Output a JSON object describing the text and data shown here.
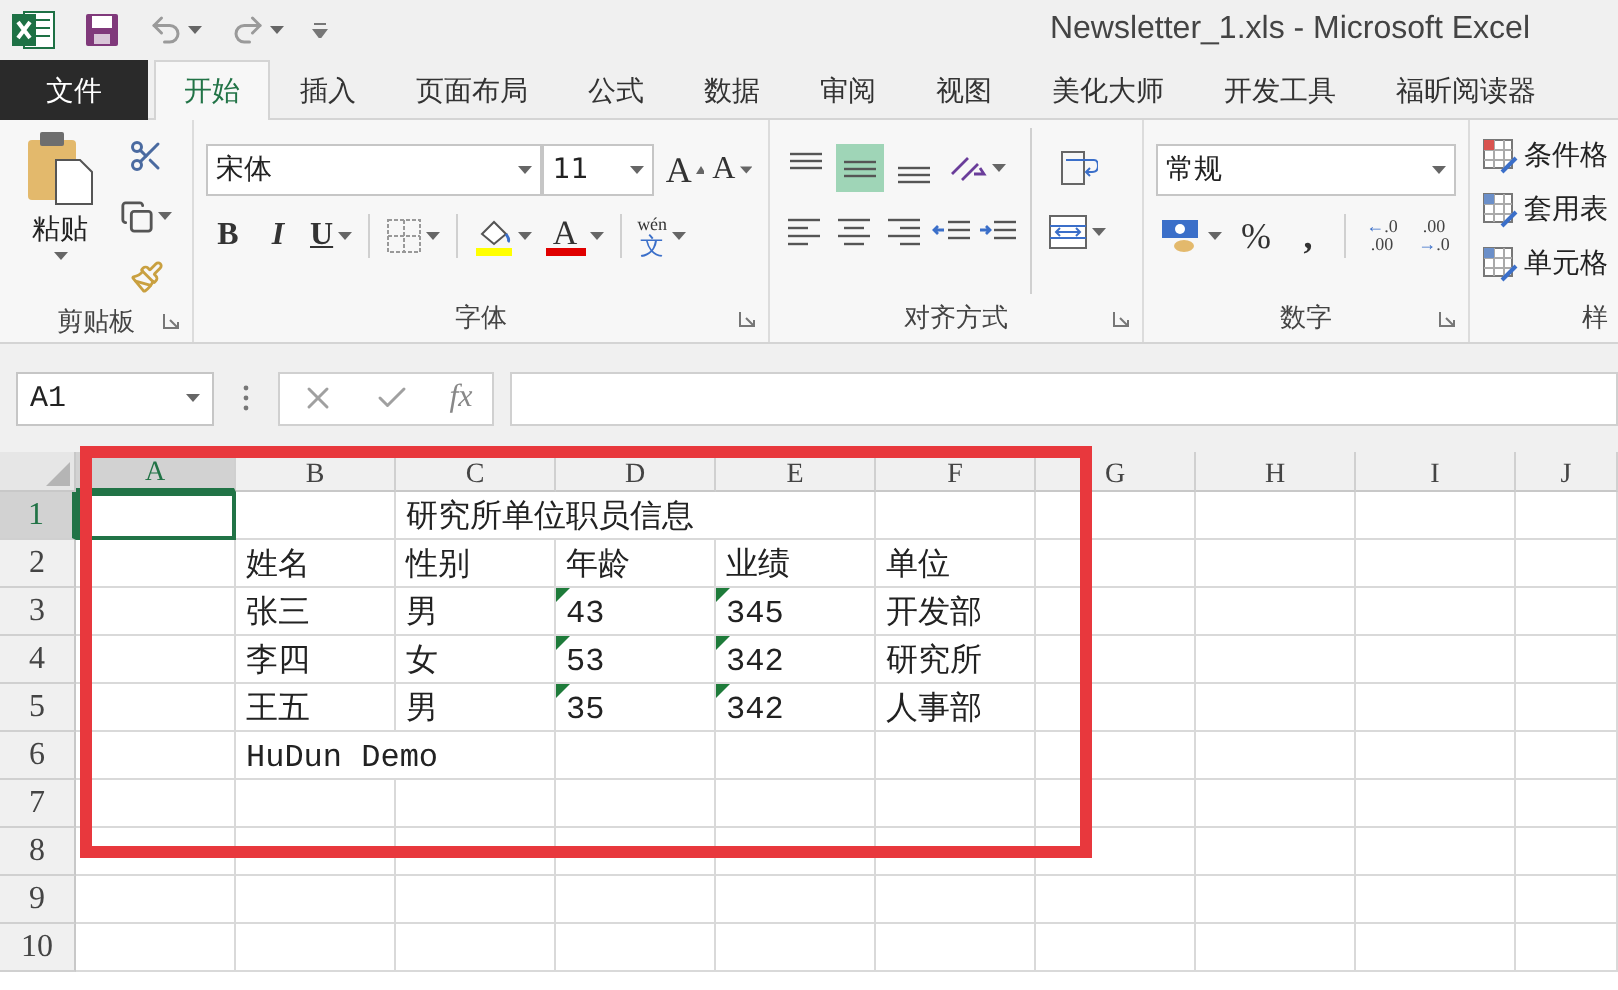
{
  "title_bar": {
    "title": "Newsletter_1.xls - Microsoft Excel"
  },
  "ribbon_tabs": [
    {
      "label": "文件",
      "kind": "file",
      "selected": false
    },
    {
      "label": "开始",
      "kind": "tab",
      "selected": true
    },
    {
      "label": "插入",
      "kind": "tab",
      "selected": false
    },
    {
      "label": "页面布局",
      "kind": "tab",
      "selected": false
    },
    {
      "label": "公式",
      "kind": "tab",
      "selected": false
    },
    {
      "label": "数据",
      "kind": "tab",
      "selected": false
    },
    {
      "label": "审阅",
      "kind": "tab",
      "selected": false
    },
    {
      "label": "视图",
      "kind": "tab",
      "selected": false
    },
    {
      "label": "美化大师",
      "kind": "tab",
      "selected": false
    },
    {
      "label": "开发工具",
      "kind": "tab",
      "selected": false
    },
    {
      "label": "福昕阅读器",
      "kind": "tab",
      "selected": false
    }
  ],
  "ribbon": {
    "clipboard": {
      "paste": "粘贴",
      "label": "剪贴板"
    },
    "font": {
      "name": "宋体",
      "size": "11",
      "grow": "A",
      "shrink": "A",
      "bold": "B",
      "italic": "I",
      "underline": "U",
      "font_color": "A",
      "phonetic": {
        "pinyin": "wén",
        "hanzi": "文"
      },
      "label": "字体"
    },
    "alignment": {
      "vertical": [
        {
          "kind": "top",
          "selected": false
        },
        {
          "kind": "middle",
          "selected": true
        },
        {
          "kind": "bottom",
          "selected": false
        }
      ],
      "label": "对齐方式"
    },
    "number": {
      "format": "常规",
      "percent": "%",
      "comma": ",",
      "increase_decimal": {
        "arrow": "←",
        "top": ".0",
        "bottom": ".00"
      },
      "decrease_decimal": {
        "top": ".00",
        "arrow": "→",
        "bottom": ".0"
      },
      "label": "数字"
    },
    "styles": {
      "items": [
        "条件格",
        "套用表",
        "单元格"
      ],
      "label": "样"
    }
  },
  "formula_bar": {
    "name_box": "A1",
    "function_label": "fx"
  },
  "sheet": {
    "columns": [
      {
        "label": "A",
        "selected": true
      },
      {
        "label": "B",
        "selected": false
      },
      {
        "label": "C",
        "selected": false
      },
      {
        "label": "D",
        "selected": false
      },
      {
        "label": "E",
        "selected": false
      },
      {
        "label": "F",
        "selected": false
      },
      {
        "label": "G",
        "selected": false
      },
      {
        "label": "H",
        "selected": false
      },
      {
        "label": "I",
        "selected": false
      },
      {
        "label": "J",
        "selected": false
      }
    ],
    "rows": [
      {
        "header": "1",
        "selected": true,
        "cells": [
          {
            "kind": "empty"
          },
          {
            "kind": "empty"
          },
          {
            "kind": "text",
            "text": "研究所单位职员信息",
            "warning": false
          }
        ]
      },
      {
        "header": "2",
        "selected": false,
        "cells": [
          {
            "kind": "empty"
          },
          {
            "kind": "text",
            "text": "姓名",
            "warning": false
          },
          {
            "kind": "text",
            "text": "性别",
            "warning": false
          },
          {
            "kind": "text",
            "text": "年龄",
            "warning": false
          },
          {
            "kind": "text",
            "text": "业绩",
            "warning": false
          },
          {
            "kind": "text",
            "text": "单位",
            "warning": false
          }
        ]
      },
      {
        "header": "3",
        "selected": false,
        "cells": [
          {
            "kind": "empty"
          },
          {
            "kind": "text",
            "text": "张三",
            "warning": false
          },
          {
            "kind": "text",
            "text": "男",
            "warning": false
          },
          {
            "kind": "text",
            "text": "43",
            "warning": true
          },
          {
            "kind": "text",
            "text": "345",
            "warning": true
          },
          {
            "kind": "text",
            "text": "开发部",
            "warning": false
          }
        ]
      },
      {
        "header": "4",
        "selected": false,
        "cells": [
          {
            "kind": "empty"
          },
          {
            "kind": "text",
            "text": "李四",
            "warning": false
          },
          {
            "kind": "text",
            "text": "女",
            "warning": false
          },
          {
            "kind": "text",
            "text": "53",
            "warning": true
          },
          {
            "kind": "text",
            "text": "342",
            "warning": true
          },
          {
            "kind": "text",
            "text": "研究所",
            "warning": false
          }
        ]
      },
      {
        "header": "5",
        "selected": false,
        "cells": [
          {
            "kind": "empty"
          },
          {
            "kind": "text",
            "text": "王五",
            "warning": false
          },
          {
            "kind": "text",
            "text": "男",
            "warning": false
          },
          {
            "kind": "text",
            "text": "35",
            "warning": true
          },
          {
            "kind": "text",
            "text": "342",
            "warning": true
          },
          {
            "kind": "text",
            "text": "人事部",
            "warning": false
          }
        ]
      },
      {
        "header": "6",
        "selected": false,
        "cells": [
          {
            "kind": "empty"
          },
          {
            "kind": "text",
            "text": "HuDun Demo",
            "warning": false
          }
        ]
      },
      {
        "header": "7",
        "selected": false
      },
      {
        "header": "8",
        "selected": false
      },
      {
        "header": "9",
        "selected": false
      },
      {
        "header": "10",
        "selected": false
      }
    ]
  }
}
